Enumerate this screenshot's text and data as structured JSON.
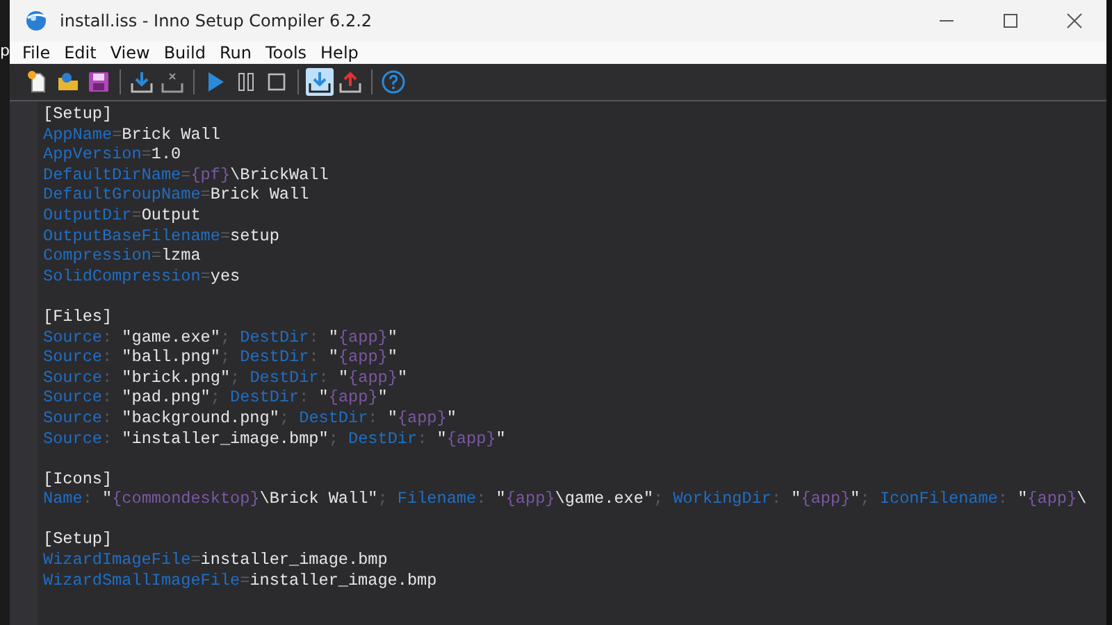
{
  "desktop_fragment": "p",
  "window": {
    "title": "install.iss - Inno Setup Compiler 6.2.2"
  },
  "menu": [
    "File",
    "Edit",
    "View",
    "Build",
    "Run",
    "Tools",
    "Help"
  ],
  "toolbar": [
    {
      "kind": "new",
      "pressed": false
    },
    {
      "kind": "open",
      "pressed": false
    },
    {
      "kind": "save",
      "pressed": false
    },
    {
      "kind": "sep"
    },
    {
      "kind": "compile",
      "pressed": false
    },
    {
      "kind": "stop-compile",
      "pressed": false
    },
    {
      "kind": "sep"
    },
    {
      "kind": "run",
      "pressed": false
    },
    {
      "kind": "pause",
      "pressed": false
    },
    {
      "kind": "stop",
      "pressed": false
    },
    {
      "kind": "sep"
    },
    {
      "kind": "install",
      "pressed": true
    },
    {
      "kind": "uninstall",
      "pressed": false
    },
    {
      "kind": "sep"
    },
    {
      "kind": "help",
      "pressed": false
    }
  ],
  "editor": {
    "sections": [
      [
        [
          {
            "kind": "section",
            "text": "[Setup]"
          }
        ],
        [
          {
            "kind": "key",
            "text": "AppName"
          },
          {
            "kind": "punct",
            "text": "="
          },
          {
            "kind": "value",
            "text": "Brick Wall"
          }
        ],
        [
          {
            "kind": "key",
            "text": "AppVersion"
          },
          {
            "kind": "punct",
            "text": "="
          },
          {
            "kind": "value",
            "text": "1.0"
          }
        ],
        [
          {
            "kind": "key",
            "text": "DefaultDirName"
          },
          {
            "kind": "punct",
            "text": "="
          },
          {
            "kind": "const",
            "text": "{pf}"
          },
          {
            "kind": "value",
            "text": "\\BrickWall"
          }
        ],
        [
          {
            "kind": "key",
            "text": "DefaultGroupName"
          },
          {
            "kind": "punct",
            "text": "="
          },
          {
            "kind": "value",
            "text": "Brick Wall"
          }
        ],
        [
          {
            "kind": "key",
            "text": "OutputDir"
          },
          {
            "kind": "punct",
            "text": "="
          },
          {
            "kind": "value",
            "text": "Output"
          }
        ],
        [
          {
            "kind": "key",
            "text": "OutputBaseFilename"
          },
          {
            "kind": "punct",
            "text": "="
          },
          {
            "kind": "value",
            "text": "setup"
          }
        ],
        [
          {
            "kind": "key",
            "text": "Compression"
          },
          {
            "kind": "punct",
            "text": "="
          },
          {
            "kind": "value",
            "text": "lzma"
          }
        ],
        [
          {
            "kind": "key",
            "text": "SolidCompression"
          },
          {
            "kind": "punct",
            "text": "="
          },
          {
            "kind": "value",
            "text": "yes"
          }
        ]
      ],
      [
        [
          {
            "kind": "section",
            "text": "[Files]"
          }
        ],
        [
          {
            "kind": "key",
            "text": "Source"
          },
          {
            "kind": "punct",
            "text": ": "
          },
          {
            "kind": "value",
            "text": "\"game.exe\""
          },
          {
            "kind": "punct",
            "text": "; "
          },
          {
            "kind": "key",
            "text": "DestDir"
          },
          {
            "kind": "punct",
            "text": ": "
          },
          {
            "kind": "value",
            "text": "\""
          },
          {
            "kind": "const",
            "text": "{app}"
          },
          {
            "kind": "value",
            "text": "\""
          }
        ],
        [
          {
            "kind": "key",
            "text": "Source"
          },
          {
            "kind": "punct",
            "text": ": "
          },
          {
            "kind": "value",
            "text": "\"ball.png\""
          },
          {
            "kind": "punct",
            "text": "; "
          },
          {
            "kind": "key",
            "text": "DestDir"
          },
          {
            "kind": "punct",
            "text": ": "
          },
          {
            "kind": "value",
            "text": "\""
          },
          {
            "kind": "const",
            "text": "{app}"
          },
          {
            "kind": "value",
            "text": "\""
          }
        ],
        [
          {
            "kind": "key",
            "text": "Source"
          },
          {
            "kind": "punct",
            "text": ": "
          },
          {
            "kind": "value",
            "text": "\"brick.png\""
          },
          {
            "kind": "punct",
            "text": "; "
          },
          {
            "kind": "key",
            "text": "DestDir"
          },
          {
            "kind": "punct",
            "text": ": "
          },
          {
            "kind": "value",
            "text": "\""
          },
          {
            "kind": "const",
            "text": "{app}"
          },
          {
            "kind": "value",
            "text": "\""
          }
        ],
        [
          {
            "kind": "key",
            "text": "Source"
          },
          {
            "kind": "punct",
            "text": ": "
          },
          {
            "kind": "value",
            "text": "\"pad.png\""
          },
          {
            "kind": "punct",
            "text": "; "
          },
          {
            "kind": "key",
            "text": "DestDir"
          },
          {
            "kind": "punct",
            "text": ": "
          },
          {
            "kind": "value",
            "text": "\""
          },
          {
            "kind": "const",
            "text": "{app}"
          },
          {
            "kind": "value",
            "text": "\""
          }
        ],
        [
          {
            "kind": "key",
            "text": "Source"
          },
          {
            "kind": "punct",
            "text": ": "
          },
          {
            "kind": "value",
            "text": "\"background.png\""
          },
          {
            "kind": "punct",
            "text": "; "
          },
          {
            "kind": "key",
            "text": "DestDir"
          },
          {
            "kind": "punct",
            "text": ": "
          },
          {
            "kind": "value",
            "text": "\""
          },
          {
            "kind": "const",
            "text": "{app}"
          },
          {
            "kind": "value",
            "text": "\""
          }
        ],
        [
          {
            "kind": "key",
            "text": "Source"
          },
          {
            "kind": "punct",
            "text": ": "
          },
          {
            "kind": "value",
            "text": "\"installer_image.bmp\""
          },
          {
            "kind": "punct",
            "text": "; "
          },
          {
            "kind": "key",
            "text": "DestDir"
          },
          {
            "kind": "punct",
            "text": ": "
          },
          {
            "kind": "value",
            "text": "\""
          },
          {
            "kind": "const",
            "text": "{app}"
          },
          {
            "kind": "value",
            "text": "\""
          }
        ]
      ],
      [
        [
          {
            "kind": "section",
            "text": "[Icons]"
          }
        ],
        [
          {
            "kind": "key",
            "text": "Name"
          },
          {
            "kind": "punct",
            "text": ": "
          },
          {
            "kind": "value",
            "text": "\""
          },
          {
            "kind": "const",
            "text": "{commondesktop}"
          },
          {
            "kind": "value",
            "text": "\\Brick Wall\""
          },
          {
            "kind": "punct",
            "text": "; "
          },
          {
            "kind": "key",
            "text": "Filename"
          },
          {
            "kind": "punct",
            "text": ": "
          },
          {
            "kind": "value",
            "text": "\""
          },
          {
            "kind": "const",
            "text": "{app}"
          },
          {
            "kind": "value",
            "text": "\\game.exe\""
          },
          {
            "kind": "punct",
            "text": "; "
          },
          {
            "kind": "key",
            "text": "WorkingDir"
          },
          {
            "kind": "punct",
            "text": ": "
          },
          {
            "kind": "value",
            "text": "\""
          },
          {
            "kind": "const",
            "text": "{app}"
          },
          {
            "kind": "value",
            "text": "\""
          },
          {
            "kind": "punct",
            "text": "; "
          },
          {
            "kind": "key",
            "text": "IconFilename"
          },
          {
            "kind": "punct",
            "text": ": "
          },
          {
            "kind": "value",
            "text": "\""
          },
          {
            "kind": "const",
            "text": "{app}"
          },
          {
            "kind": "value",
            "text": "\\"
          }
        ]
      ],
      [
        [
          {
            "kind": "section",
            "text": "[Setup]"
          }
        ],
        [
          {
            "kind": "key",
            "text": "WizardImageFile"
          },
          {
            "kind": "punct",
            "text": "="
          },
          {
            "kind": "value",
            "text": "installer_image.bmp"
          }
        ],
        [
          {
            "kind": "key",
            "text": "WizardSmallImageFile"
          },
          {
            "kind": "punct",
            "text": "="
          },
          {
            "kind": "value",
            "text": "installer_image.bmp"
          }
        ]
      ]
    ]
  }
}
